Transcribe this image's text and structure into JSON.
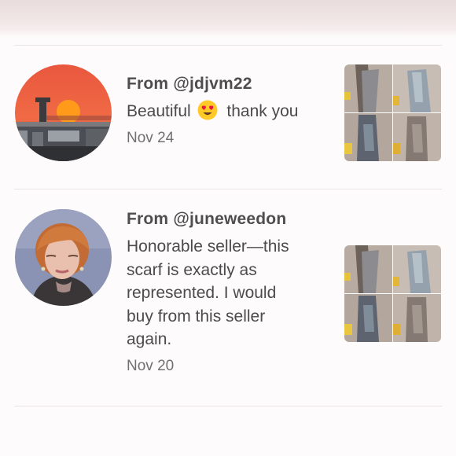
{
  "reviews": [
    {
      "from_prefix": "From ",
      "handle": "@jdjvm22",
      "text_before_emoji": "Beautiful",
      "emoji": "heart-eyes-emoji",
      "text_after_emoji": "thank you",
      "date": "Nov 24",
      "avatar": "sunset-photo-avatar",
      "thumbnail": "scarf-photo-grid"
    },
    {
      "from_prefix": "From ",
      "handle": "@juneweedon",
      "text_lines": [
        "Honorable seller—this",
        "scarf is exactly as",
        "represented. I would",
        "buy from this seller",
        "again."
      ],
      "date": "Nov 20",
      "avatar": "woman-portrait-avatar",
      "thumbnail": "scarf-photo-grid"
    }
  ]
}
